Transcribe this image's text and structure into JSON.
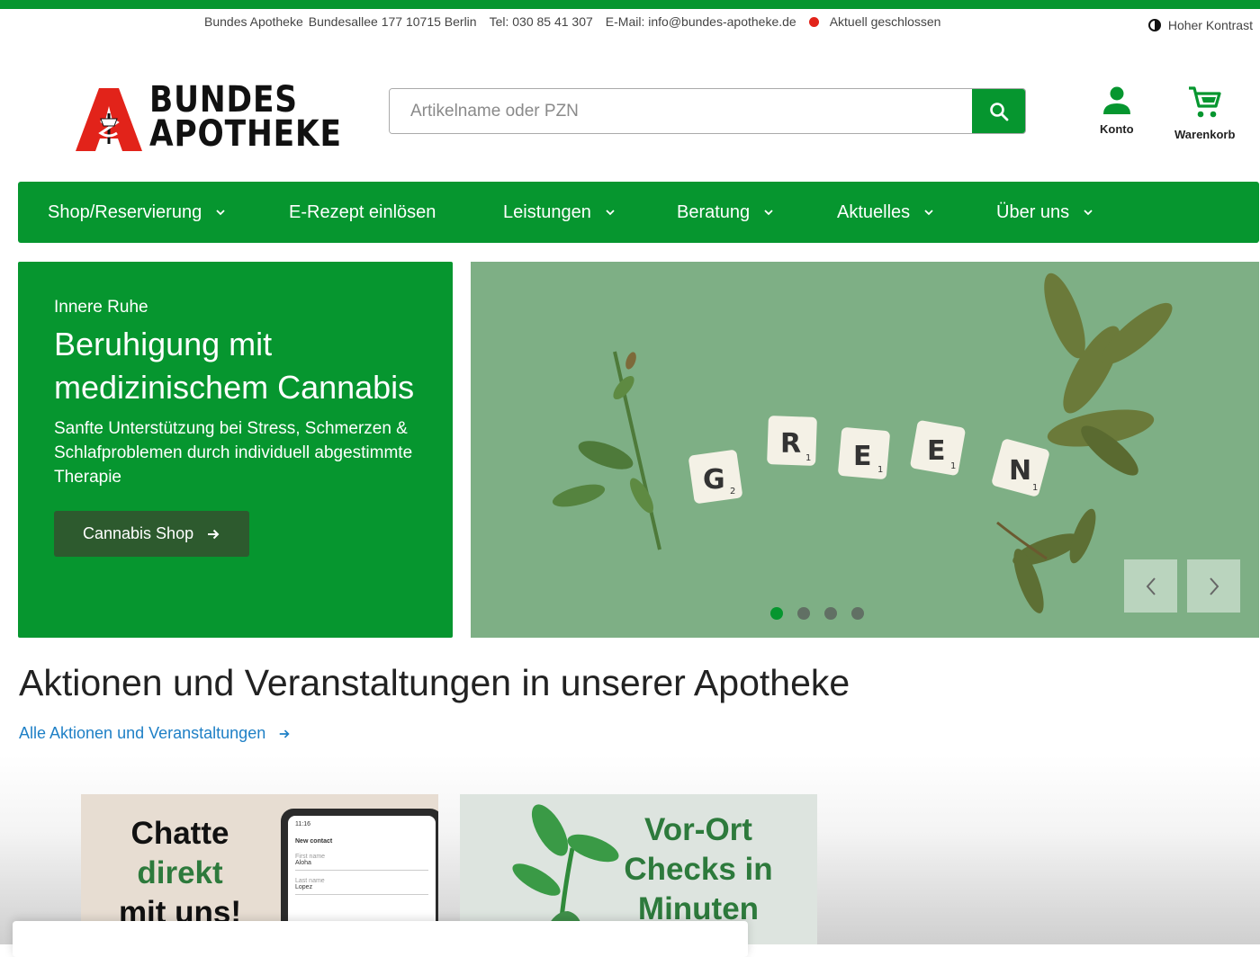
{
  "info": {
    "name": "Bundes Apotheke",
    "address": "Bundesallee 177  10715 Berlin",
    "phone": "Tel:  030 85 41 307",
    "email": "E-Mail: info@bundes-apotheke.de",
    "status": "Aktuell geschlossen",
    "status_color": "#e2231a",
    "contrast": "Hoher Kontrast"
  },
  "logo": {
    "line1": "BUNDES",
    "line2": "APOTHEKE",
    "brand_color": "#e2231a"
  },
  "search": {
    "placeholder": "Artikelname oder PZN"
  },
  "header": {
    "account": "Konto",
    "cart": "Warenkorb"
  },
  "nav": {
    "items": [
      {
        "label": "Shop/Reservierung"
      },
      {
        "label": "E-Rezept einlösen"
      },
      {
        "label": "Leistungen"
      },
      {
        "label": "Beratung"
      },
      {
        "label": "Aktuelles"
      },
      {
        "label": "Über uns"
      }
    ]
  },
  "promo": {
    "kicker": "Innere Ruhe",
    "title": "Beruhigung mit medizinischem Cannabis",
    "text": "Sanfte Unterstützung bei Stress, Schmerzen & Schlafproblemen durch individuell abgestimmte Therapie",
    "cta": "Cannabis Shop"
  },
  "slider": {
    "tiles": [
      {
        "letter": "G",
        "score": "2"
      },
      {
        "letter": "R",
        "score": "1"
      },
      {
        "letter": "E",
        "score": "1"
      },
      {
        "letter": "E",
        "score": "1"
      },
      {
        "letter": "N",
        "score": "1"
      }
    ],
    "slides_total": 4,
    "active_slide": 1
  },
  "section": {
    "title": "Aktionen und Veranstaltungen in unserer Apotheke",
    "link": "Alle Aktionen und Veranstaltungen"
  },
  "cards": {
    "card1": {
      "line1": "Chatte",
      "line2": "direkt",
      "line3": "mit uns!",
      "phone_title": "New contact",
      "phone_field1": "First name",
      "phone_value1": "Aloha",
      "phone_field2": "Last name",
      "phone_value2": "Lopez",
      "phone_time": "11:16"
    },
    "card2": {
      "line1": "Vor-Ort",
      "line2": "Checks in",
      "line3": "Minuten"
    }
  },
  "colors": {
    "primary": "#06962f",
    "dark_button": "#2d5a2e",
    "link": "#1f80c6"
  }
}
